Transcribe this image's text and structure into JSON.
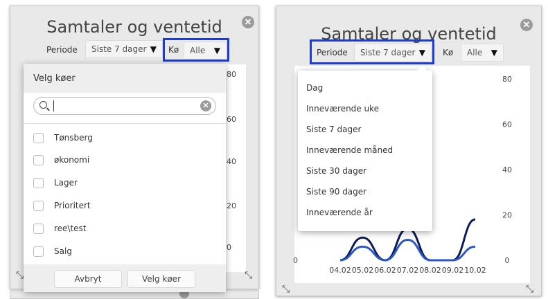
{
  "left_widget": {
    "title": "Samtaler og ventetid",
    "close_glyph": "✕",
    "periode_label": "Periode",
    "periode_value": "Siste 7 dager",
    "ko_label": "Kø",
    "ko_value": "Alle",
    "y_ticks_partial": [
      "80",
      "60",
      "40",
      "20",
      "0"
    ],
    "queue_dropdown": {
      "header": "Velg køer",
      "search_placeholder": "",
      "items": [
        "Tønsberg",
        "økonomi",
        "Lager",
        "Prioritert",
        "ree\\test",
        "Salg"
      ],
      "cancel_label": "Avbryt",
      "confirm_label": "Velg køer"
    }
  },
  "right_widget": {
    "title": "Samtaler og ventetid",
    "close_glyph": "✕",
    "periode_label": "Periode",
    "periode_value": "Siste 7 dager",
    "ko_label": "Kø",
    "ko_value": "Alle",
    "period_options": [
      "Dag",
      "Inneværende uke",
      "Siste 7 dager",
      "Inneværende måned",
      "Siste 30 dager",
      "Siste 90 dager",
      "Inneværende år"
    ],
    "left_axis_bottom": "0"
  },
  "chart_data": {
    "type": "line",
    "categories": [
      "04.02",
      "05.02",
      "06.02",
      "07.02",
      "08.02",
      "09.02",
      "10.02"
    ],
    "ylim": [
      0,
      80
    ],
    "y_ticks": [
      "80",
      "60",
      "40",
      "20",
      "0"
    ],
    "series": [
      {
        "values": [
          0,
          10,
          0,
          14,
          0,
          0,
          18
        ],
        "color": "#0d1b5a"
      },
      {
        "values": [
          0,
          6,
          0,
          9,
          0,
          0,
          6
        ],
        "color": "#2a56c6"
      }
    ]
  },
  "icons": {
    "arrow": "▼",
    "resize": "⤡"
  }
}
